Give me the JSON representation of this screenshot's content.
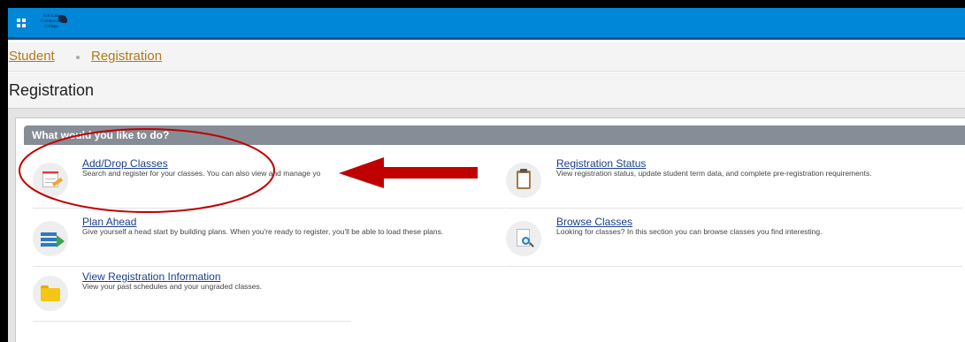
{
  "header": {
    "logo_text": [
      "Salt Lake",
      "Community",
      "College"
    ]
  },
  "breadcrumb": {
    "items": [
      "Student",
      "Registration"
    ]
  },
  "page": {
    "title": "Registration"
  },
  "panel": {
    "header": "What would you like to do?"
  },
  "actions": [
    {
      "title": "Add/Drop Classes",
      "description": "Search and register for your classes. You can also view and manage yo",
      "icon": "calendar-edit-icon"
    },
    {
      "title": "Registration Status",
      "description": "View registration status, update student term data, and complete pre-registration requirements.",
      "icon": "clipboard-icon"
    },
    {
      "title": "Plan Ahead",
      "description": "Give yourself a head start by building plans. When you're ready to register, you'll be able to load these plans.",
      "icon": "plan-stack-icon"
    },
    {
      "title": "Browse Classes",
      "description": "Looking for classes? In this section you can browse classes you find interesting.",
      "icon": "document-search-icon"
    },
    {
      "title": "View Registration Information",
      "description": "View your past schedules and your ungraded classes.",
      "icon": "folder-icon"
    }
  ],
  "colors": {
    "topbar": "#0187d7",
    "link": "#1b3f8b",
    "breadcrumb_link": "#b27b16",
    "panel_header": "#868d96",
    "annotation": "#c00000"
  }
}
